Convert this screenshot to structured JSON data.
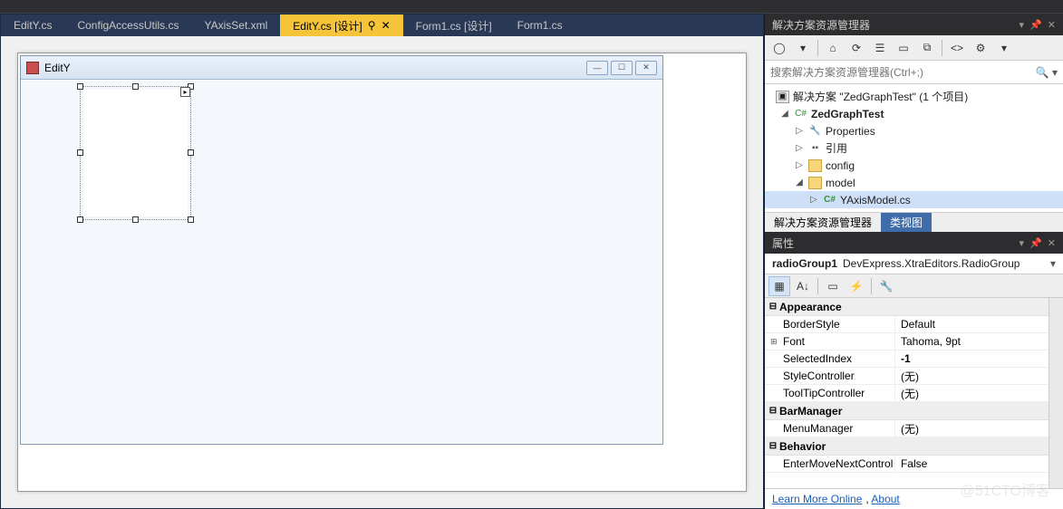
{
  "tabs": [
    {
      "label": "EditY.cs"
    },
    {
      "label": "ConfigAccessUtils.cs"
    },
    {
      "label": "YAxisSet.xml"
    },
    {
      "label": "EditY.cs [设计]",
      "active": true
    },
    {
      "label": "Form1.cs [设计]"
    },
    {
      "label": "Form1.cs"
    }
  ],
  "form": {
    "title": "EditY"
  },
  "solutionExplorer": {
    "title": "解决方案资源管理器",
    "searchPlaceholder": "搜索解决方案资源管理器(Ctrl+;)",
    "tree": {
      "solution": "解决方案 \"ZedGraphTest\" (1 个项目)",
      "project": "ZedGraphTest",
      "properties": "Properties",
      "references": "引用",
      "config": "config",
      "model": "model",
      "modelFile": "YAxisModel.cs"
    },
    "tabs": [
      "解决方案资源管理器",
      "类视图"
    ]
  },
  "properties": {
    "title": "属性",
    "selectedName": "radioGroup1",
    "selectedType": "DevExpress.XtraEditors.RadioGroup",
    "groups": [
      {
        "name": "Appearance",
        "rows": [
          {
            "k": "BorderStyle",
            "v": "Default"
          },
          {
            "k": "Font",
            "v": "Tahoma, 9pt",
            "expandable": true
          },
          {
            "k": "SelectedIndex",
            "v": "-1",
            "bold": true
          },
          {
            "k": "StyleController",
            "v": "(无)"
          },
          {
            "k": "ToolTipController",
            "v": "(无)"
          }
        ]
      },
      {
        "name": "BarManager",
        "rows": [
          {
            "k": "MenuManager",
            "v": "(无)"
          }
        ]
      },
      {
        "name": "Behavior",
        "rows": [
          {
            "k": "EnterMoveNextControl",
            "v": "False"
          }
        ]
      }
    ],
    "links": [
      "Learn More Online",
      "About"
    ]
  },
  "watermark": "@51CTO博客"
}
